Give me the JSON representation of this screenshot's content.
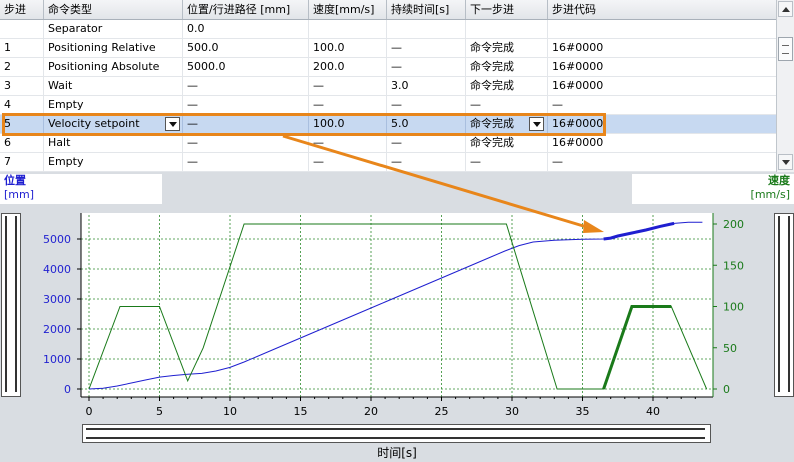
{
  "table": {
    "headers": [
      "步进",
      "命令类型",
      "位置/行进路径 [mm]",
      "速度[mm/s]",
      "持续时间[s]",
      "下一步进",
      "步进代码"
    ],
    "rows": [
      [
        "",
        "Separator",
        "0.0",
        "",
        "",
        "",
        ""
      ],
      [
        "1",
        "Positioning Relative",
        "500.0",
        "100.0",
        "—",
        "命令完成",
        "16#0000"
      ],
      [
        "2",
        "Positioning Absolute",
        "5000.0",
        "200.0",
        "—",
        "命令完成",
        "16#0000"
      ],
      [
        "3",
        "Wait",
        "—",
        "—",
        "3.0",
        "命令完成",
        "16#0000"
      ],
      [
        "4",
        "Empty",
        "—",
        "—",
        "—",
        "—",
        "—"
      ],
      [
        "5",
        "Velocity setpoint",
        "—",
        "100.0",
        "5.0",
        "命令完成",
        "16#0000"
      ],
      [
        "6",
        "Halt",
        "—",
        "—",
        "—",
        "命令完成",
        "16#0000"
      ],
      [
        "7",
        "Empty",
        "—",
        "—",
        "—",
        "—",
        "—"
      ]
    ],
    "selected_row": 5
  },
  "axes_labels": {
    "left_title": "位置",
    "left_unit": "[mm]",
    "right_title": "速度",
    "right_unit": "[mm/s]",
    "x_label": "时间[s]"
  },
  "colors": {
    "position": "#1f1fd0",
    "velocity": "#1a7a1a",
    "highlight": "#e8861b",
    "grid": "#2e8b2e"
  },
  "chart_data": {
    "type": "line",
    "xlim": [
      0,
      44
    ],
    "xticks": [
      0,
      5,
      10,
      15,
      20,
      25,
      30,
      35,
      40
    ],
    "y_left": {
      "lim": [
        0,
        5800
      ],
      "ticks": [
        0,
        1000,
        2000,
        3000,
        4000,
        5000
      ]
    },
    "y_right": {
      "lim": [
        0,
        210
      ],
      "ticks": [
        0,
        50,
        100,
        150,
        200
      ]
    },
    "grid": true,
    "series": [
      {
        "axis": "left",
        "x": [
          0,
          1,
          2,
          3,
          4,
          5,
          6,
          7,
          8,
          9,
          10,
          11,
          13,
          15,
          17,
          19,
          21,
          23,
          25,
          27,
          28.5,
          29.5,
          30.5,
          31.5,
          33,
          35,
          36.5,
          37,
          37.5,
          38.5,
          39.5,
          40.5,
          41.5,
          42.5,
          43.5
        ],
        "y": [
          0,
          25,
          100,
          200,
          300,
          395,
          450,
          490,
          520,
          600,
          720,
          900,
          1300,
          1700,
          2100,
          2500,
          2900,
          3300,
          3700,
          4100,
          4400,
          4600,
          4780,
          4900,
          4960,
          4990,
          5000,
          5030,
          5100,
          5200,
          5300,
          5420,
          5520,
          5560,
          5560
        ]
      },
      {
        "axis": "right",
        "x": [
          0,
          2.2,
          5,
          7,
          8.1,
          11,
          29.6,
          30.5,
          33.2,
          36.5,
          38.5,
          41.3,
          43.8
        ],
        "y": [
          0,
          100,
          100,
          10,
          50,
          200,
          200,
          150,
          0,
          0,
          100,
          100,
          0
        ]
      }
    ],
    "highlight": {
      "x": [
        36.5,
        41.5
      ]
    }
  }
}
